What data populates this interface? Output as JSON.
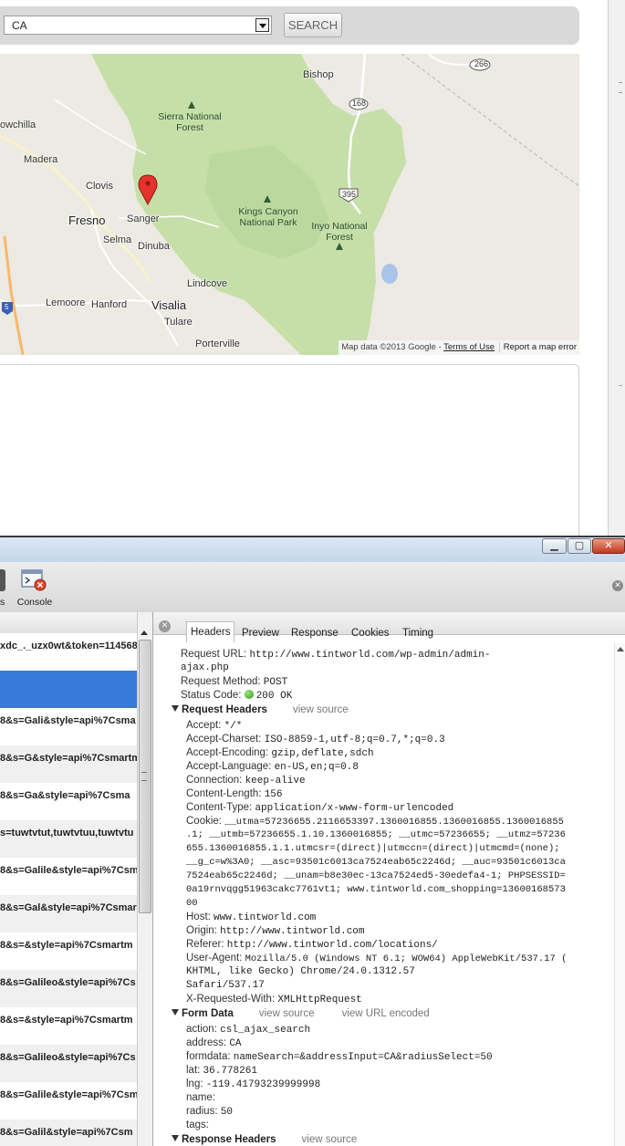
{
  "search": {
    "location_value": "CA",
    "button_label": "SEARCH"
  },
  "map": {
    "places": [
      "Bishop",
      "Sierra National Forest",
      "owchilla",
      "Madera",
      "Clovis",
      "Fresno",
      "Sanger",
      "Kings Canyon National Park",
      "Selma",
      "Dinuba",
      "Inyo National Forest",
      "Lindcove",
      "Lemoore",
      "Hanford",
      "Visalia",
      "Tulare",
      "Porterville"
    ],
    "highways": [
      "266",
      "168",
      "395",
      "5"
    ],
    "attribution": "Map data ©2013 Google -",
    "terms_link": "Terms of Use",
    "report_link": "Report a map error"
  },
  "devtools": {
    "window_buttons": [
      "minimize",
      "maximize",
      "close"
    ],
    "toolbar": {
      "left_cut_label": "s",
      "console_label": "Console"
    },
    "requests": [
      "xdc_._uzx0wt&token=114568",
      "",
      "8&s=Gali&style=api%7Csma",
      "8&s=G&style=api%7Csmartm",
      "8&s=Ga&style=api%7Csma",
      "s=tuwtvtut,tuwtvtuu,tuwtvtu",
      "8&s=Galile&style=api%7Csm",
      "8&s=Gal&style=api%7Csmar",
      "8&s=&style=api%7Csmartm",
      "8&s=Galileo&style=api%7Cs",
      "8&s=&style=api%7Csmartm",
      "8&s=Galileo&style=api%7Cs",
      "8&s=Galile&style=api%7Csm",
      "8&s=Galil&style=api%7Csm"
    ],
    "tabs": [
      "Headers",
      "Preview",
      "Response",
      "Cookies",
      "Timing"
    ],
    "general": {
      "request_url_label": "Request URL:",
      "request_url_1": "http://www.tintworld.com/wp-admin/admin-",
      "request_url_2": "ajax.php",
      "method_label": "Request Method:",
      "method": "POST",
      "status_label": "Status Code:",
      "status": "200 OK"
    },
    "request_headers_title": "Request Headers",
    "view_source": "view source",
    "request_headers": [
      {
        "k": "Accept:",
        "v": "*/*"
      },
      {
        "k": "Accept-Charset:",
        "v": "ISO-8859-1,utf-8;q=0.7,*;q=0.3"
      },
      {
        "k": "Accept-Encoding:",
        "v": "gzip,deflate,sdch"
      },
      {
        "k": "Accept-Language:",
        "v": "en-US,en;q=0.8"
      },
      {
        "k": "Connection:",
        "v": "keep-alive"
      },
      {
        "k": "Content-Length:",
        "v": "156"
      },
      {
        "k": "Content-Type:",
        "v": "application/x-www-form-urlencoded"
      },
      {
        "k": "Cookie:",
        "v": "__utma=57236655.2116653397.1360016855.1360016855.1360016855"
      },
      {
        "k": "Host:",
        "v": "www.tintworld.com"
      },
      {
        "k": "Origin:",
        "v": "http://www.tintworld.com"
      },
      {
        "k": "Referer:",
        "v": "http://www.tintworld.com/locations/"
      },
      {
        "k": "User-Agent:",
        "v": "Mozilla/5.0 (Windows NT 6.1; WOW64) AppleWebKit/537.17 ("
      },
      {
        "k": "X-Requested-With:",
        "v": "XMLHttpRequest"
      }
    ],
    "cookie_cont": [
      ".1; __utmb=57236655.1.10.1360016855; __utmc=57236655; __utmz=57236",
      "655.1360016855.1.1.utmcsr=(direct)|utmccn=(direct)|utmcmd=(none);",
      "__g_c=w%3A0; __asc=93501c6013ca7524eab65c2246d; __auc=93501c6013ca",
      "7524eab65c2246d; __unam=b8e30ec-13ca7524ed5-30edefa4-1; PHPSESSID=",
      "0a19rnvqgg51963cakc7761vt1; www.tintworld.com_shopping=13600168573",
      "00"
    ],
    "ua_cont": [
      "KHTML, like Gecko) Chrome/24.0.1312.57",
      "Safari/537.17"
    ],
    "form_data_title": "Form Data",
    "view_url_encoded": "view URL encoded",
    "form_data": [
      {
        "k": "action:",
        "v": "csl_ajax_search"
      },
      {
        "k": "address:",
        "v": "CA"
      },
      {
        "k": "formdata:",
        "v": "nameSearch=&addressInput=CA&radiusSelect=50"
      },
      {
        "k": "lat:",
        "v": "36.778261"
      },
      {
        "k": "lng:",
        "v": "-119.41793239999998"
      },
      {
        "k": "name:",
        "v": ""
      },
      {
        "k": "radius:",
        "v": "50"
      },
      {
        "k": "tags:",
        "v": ""
      }
    ],
    "response_headers_title": "Response Headers"
  }
}
